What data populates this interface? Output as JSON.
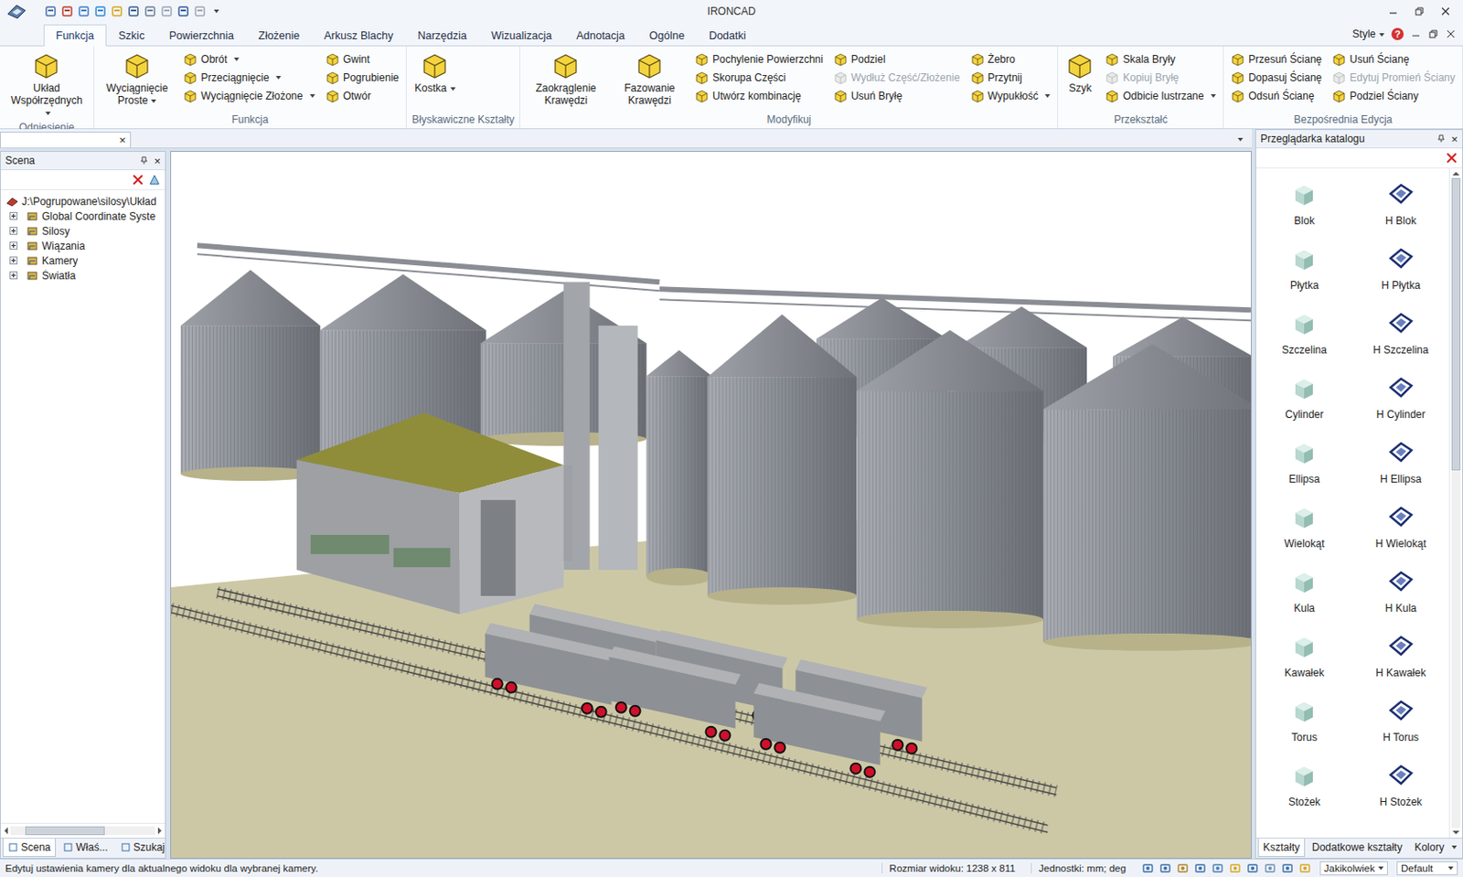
{
  "window": {
    "title": "IRONCAD"
  },
  "tabs": [
    {
      "label": "Funkcja",
      "selected": true
    },
    {
      "label": "Szkic",
      "selected": false
    },
    {
      "label": "Powierzchnia",
      "selected": false
    },
    {
      "label": "Złożenie",
      "selected": false
    },
    {
      "label": "Arkusz Blachy",
      "selected": false
    },
    {
      "label": "Narzędzia",
      "selected": false
    },
    {
      "label": "Wizualizacja",
      "selected": false
    },
    {
      "label": "Adnotacja",
      "selected": false
    },
    {
      "label": "Ogólne",
      "selected": false
    },
    {
      "label": "Dodatki",
      "selected": false
    }
  ],
  "style_menu": {
    "label": "Style",
    "dropdown": true
  },
  "help": "?",
  "ribbon": {
    "groups": [
      {
        "label": "Odniesienie",
        "columns": [
          {
            "kind": "large",
            "items": [
              {
                "label": "Układ Współrzędnych",
                "dropdown": true,
                "disabled": false
              }
            ]
          }
        ]
      },
      {
        "label": "Funkcja",
        "columns": [
          {
            "kind": "large",
            "items": [
              {
                "label": "Wyciągnięcie Proste",
                "dropdown": true,
                "disabled": false
              }
            ]
          },
          {
            "kind": "small",
            "items": [
              {
                "label": "Obrót",
                "dropdown": true,
                "disabled": false
              },
              {
                "label": "Przeciągnięcie",
                "dropdown": true,
                "disabled": false
              },
              {
                "label": "Wyciągnięcie Złożone",
                "dropdown": true,
                "disabled": false
              }
            ]
          },
          {
            "kind": "small",
            "items": [
              {
                "label": "Gwint",
                "dropdown": false,
                "disabled": false
              },
              {
                "label": "Pogrubienie",
                "dropdown": false,
                "disabled": false
              },
              {
                "label": "Otwór",
                "dropdown": false,
                "disabled": false
              }
            ]
          }
        ]
      },
      {
        "label": "Błyskawiczne Kształty",
        "columns": [
          {
            "kind": "large",
            "items": [
              {
                "label": "Kostka",
                "dropdown": true,
                "disabled": false
              }
            ]
          }
        ]
      },
      {
        "label": "Modyfikuj",
        "columns": [
          {
            "kind": "large",
            "items": [
              {
                "label": "Zaokrąglenie Krawędzi",
                "dropdown": false,
                "disabled": false
              }
            ]
          },
          {
            "kind": "large",
            "items": [
              {
                "label": "Fazowanie Krawędzi",
                "dropdown": false,
                "disabled": false
              }
            ]
          },
          {
            "kind": "small",
            "items": [
              {
                "label": "Pochylenie Powierzchni",
                "dropdown": false,
                "disabled": false
              },
              {
                "label": "Skorupa Części",
                "dropdown": false,
                "disabled": false
              },
              {
                "label": "Utwórz kombinację",
                "dropdown": false,
                "disabled": false
              }
            ]
          },
          {
            "kind": "small",
            "items": [
              {
                "label": "Podziel",
                "dropdown": false,
                "disabled": false
              },
              {
                "label": "Wydłuż Część/Złożenie",
                "dropdown": false,
                "disabled": true
              },
              {
                "label": "Usuń Bryłę",
                "dropdown": false,
                "disabled": false
              }
            ]
          },
          {
            "kind": "small",
            "items": [
              {
                "label": "Żebro",
                "dropdown": false,
                "disabled": false
              },
              {
                "label": "Przytnij",
                "dropdown": false,
                "disabled": false
              },
              {
                "label": "Wypukłość",
                "dropdown": true,
                "disabled": false
              }
            ]
          }
        ]
      },
      {
        "label": "Przekształć",
        "columns": [
          {
            "kind": "large",
            "items": [
              {
                "label": "Szyk",
                "dropdown": false,
                "disabled": false
              }
            ]
          },
          {
            "kind": "small",
            "items": [
              {
                "label": "Skala Bryły",
                "dropdown": false,
                "disabled": false
              },
              {
                "label": "Kopiuj Bryłę",
                "dropdown": false,
                "disabled": true
              },
              {
                "label": "Odbicie lustrzane",
                "dropdown": true,
                "disabled": false
              }
            ]
          }
        ]
      },
      {
        "label": "Bezpośrednia Edycja",
        "columns": [
          {
            "kind": "small",
            "items": [
              {
                "label": "Przesuń Ścianę",
                "dropdown": false,
                "disabled": false
              },
              {
                "label": "Dopasuj Ścianę",
                "dropdown": false,
                "disabled": false
              },
              {
                "label": "Odsuń Ścianę",
                "dropdown": false,
                "disabled": false
              }
            ]
          },
          {
            "kind": "small",
            "items": [
              {
                "label": "Usuń Ścianę",
                "dropdown": false,
                "disabled": false
              },
              {
                "label": "Edytuj Promień Ściany",
                "dropdown": false,
                "disabled": true
              },
              {
                "label": "Podziel Ściany",
                "dropdown": false,
                "disabled": false
              }
            ]
          }
        ]
      }
    ]
  },
  "document_tab": {
    "close": "×"
  },
  "scene_panel": {
    "title": "Scena",
    "close": "×",
    "tree": [
      {
        "label": "J:\\Pogrupowane\\silosy\\Układ",
        "kind": "root",
        "expanded": true
      },
      {
        "label": "Global Coordinate Syste",
        "kind": "node",
        "expanded": false
      },
      {
        "label": "Silosy",
        "kind": "node",
        "expanded": false
      },
      {
        "label": "Wiązania",
        "kind": "node",
        "expanded": false
      },
      {
        "label": "Kamery",
        "kind": "node",
        "expanded": false
      },
      {
        "label": "Światła",
        "kind": "node",
        "expanded": false
      }
    ],
    "tabs": [
      {
        "label": "Scena",
        "selected": true
      },
      {
        "label": "Właś...",
        "selected": false
      },
      {
        "label": "Szukaj",
        "selected": false
      }
    ]
  },
  "catalog_panel": {
    "title": "Przeglądarka katalogu",
    "close": "×",
    "items": [
      {
        "label": "Blok",
        "kind": "solid"
      },
      {
        "label": "H Blok",
        "kind": "hollow"
      },
      {
        "label": "Płytka",
        "kind": "solid"
      },
      {
        "label": "H Płytka",
        "kind": "hollow"
      },
      {
        "label": "Szczelina",
        "kind": "solid"
      },
      {
        "label": "H Szczelina",
        "kind": "hollow"
      },
      {
        "label": "Cylinder",
        "kind": "solid"
      },
      {
        "label": "H Cylinder",
        "kind": "hollow"
      },
      {
        "label": "Ellipsa",
        "kind": "solid"
      },
      {
        "label": "H Ellipsa",
        "kind": "hollow"
      },
      {
        "label": "Wielokąt",
        "kind": "solid"
      },
      {
        "label": "H Wielokąt",
        "kind": "hollow"
      },
      {
        "label": "Kula",
        "kind": "solid"
      },
      {
        "label": "H Kula",
        "kind": "hollow"
      },
      {
        "label": "Kawałek",
        "kind": "solid"
      },
      {
        "label": "H Kawałek",
        "kind": "hollow"
      },
      {
        "label": "Torus",
        "kind": "solid"
      },
      {
        "label": "H Torus",
        "kind": "hollow"
      },
      {
        "label": "Stożek",
        "kind": "solid"
      },
      {
        "label": "H Stożek",
        "kind": "hollow"
      }
    ],
    "tabs": [
      {
        "label": "Kształty",
        "selected": true
      },
      {
        "label": "Dodatkowe kształty",
        "selected": false
      },
      {
        "label": "Kolory",
        "selected": false
      }
    ]
  },
  "status_bar": {
    "message": "Edytuj ustawienia kamery dla aktualnego widoku dla wybranej kamery.",
    "view_size": "Rozmiar widoku: 1238 x 811",
    "units": "Jednostki: mm; deg",
    "selection_filter": "Jakikolwiek",
    "style": "Default"
  }
}
